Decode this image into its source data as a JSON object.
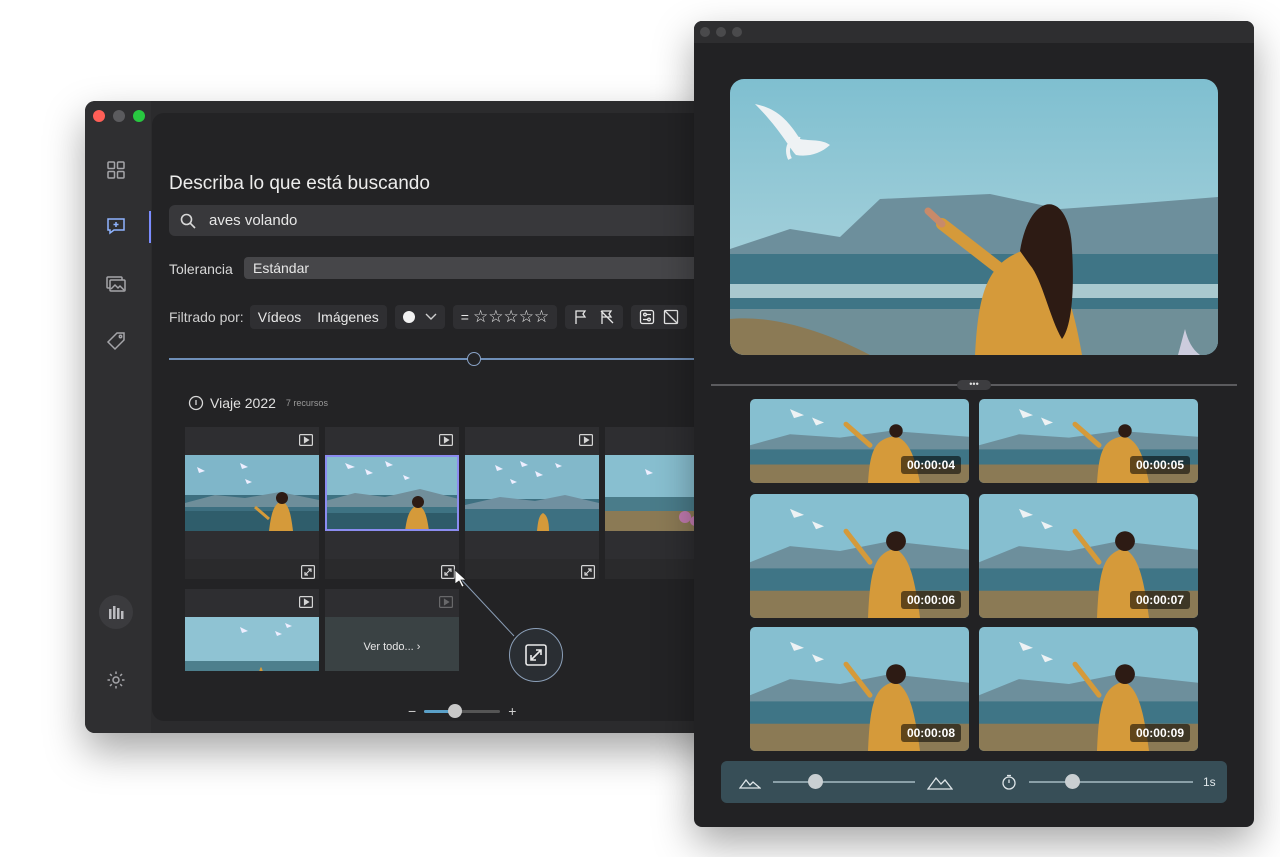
{
  "left_window": {
    "search": {
      "title": "Describa lo que está buscando",
      "value": "aves volando"
    },
    "tolerance": {
      "label": "Tolerancia",
      "value": "Estándar"
    },
    "filter": {
      "label": "Filtrado por:",
      "videos": "Vídeos",
      "images": "Imágenes",
      "rating_prefix": "="
    },
    "group": {
      "title": "Viaje 2022",
      "count": "7 recursos"
    },
    "see_all": "Ver todo...",
    "zoom": {
      "minus": "−",
      "plus": "+",
      "level": 0.4
    }
  },
  "right_window": {
    "thumbnails": [
      {
        "timecode": "00:00:04"
      },
      {
        "timecode": "00:00:05"
      },
      {
        "timecode": "00:00:06"
      },
      {
        "timecode": "00:00:07"
      },
      {
        "timecode": "00:00:08"
      },
      {
        "timecode": "00:00:09"
      }
    ],
    "interval_value": "1s",
    "split_handle": "•••"
  },
  "colors": {
    "accent": "#7b8cff",
    "selection": "#8b8cf0",
    "close": "#ff5f57",
    "minimize": "#5b5b5e",
    "maximize": "#28c840"
  }
}
